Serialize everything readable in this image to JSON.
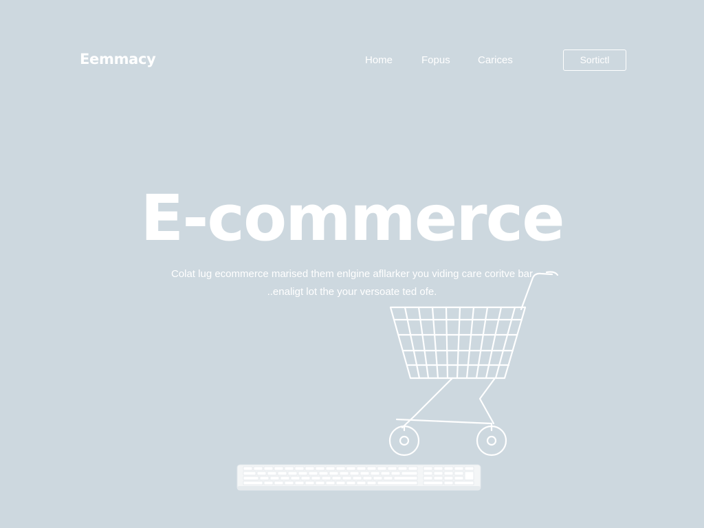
{
  "header": {
    "logo": "Eemmacy",
    "nav": [
      "Home",
      "Fopus",
      "Carices"
    ],
    "contact_label": "Sortictl"
  },
  "hero": {
    "title": "E-commerce",
    "description_line1": "Colat lug ecommerce marised them enlgine afllarker you viding care coritve bar",
    "description_line2": "..enaligt lot the your versoate ted ofe."
  },
  "illustrations": {
    "cart_icon": "shopping-cart-icon",
    "keyboard_icon": "keyboard-icon"
  },
  "colors": {
    "background": "#cdd8df",
    "foreground": "#ffffff"
  }
}
